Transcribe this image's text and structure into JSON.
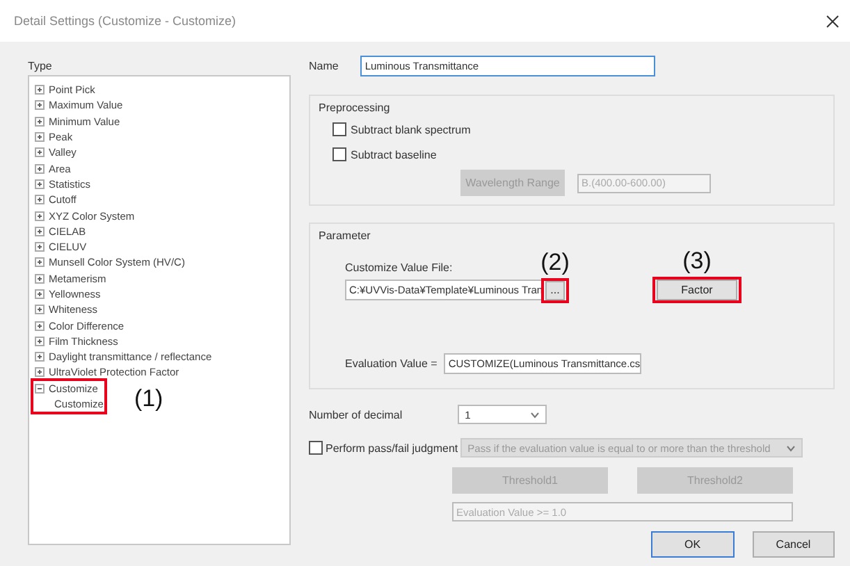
{
  "window": {
    "title": "Detail Settings (Customize - Customize)"
  },
  "type_panel": {
    "label": "Type",
    "tree": [
      {
        "label": "Point Pick",
        "expanded": false
      },
      {
        "label": "Maximum Value",
        "expanded": false
      },
      {
        "label": "Minimum Value",
        "expanded": false
      },
      {
        "label": "Peak",
        "expanded": false
      },
      {
        "label": "Valley",
        "expanded": false
      },
      {
        "label": "Area",
        "expanded": false
      },
      {
        "label": "Statistics",
        "expanded": false
      },
      {
        "label": "Cutoff",
        "expanded": false
      },
      {
        "label": "XYZ Color System",
        "expanded": false
      },
      {
        "label": "CIELAB",
        "expanded": false
      },
      {
        "label": "CIELUV",
        "expanded": false
      },
      {
        "label": "Munsell Color System (HV/C)",
        "expanded": false
      },
      {
        "label": "Metamerism",
        "expanded": false
      },
      {
        "label": "Yellowness",
        "expanded": false
      },
      {
        "label": "Whiteness",
        "expanded": false
      },
      {
        "label": "Color Difference",
        "expanded": false
      },
      {
        "label": "Film Thickness",
        "expanded": false
      },
      {
        "label": "Daylight transmittance / reflectance",
        "expanded": false
      },
      {
        "label": "UltraViolet Protection Factor",
        "expanded": false
      },
      {
        "label": "Customize",
        "expanded": true,
        "callout": "(1)",
        "children": [
          {
            "label": "Customize"
          }
        ]
      }
    ]
  },
  "name": {
    "label": "Name",
    "value": "Luminous Transmittance"
  },
  "preprocessing": {
    "title": "Preprocessing",
    "options": [
      {
        "label": "Subtract blank spectrum",
        "checked": false
      },
      {
        "label": "Subtract baseline",
        "checked": false
      }
    ],
    "range_button": {
      "label": "Wavelength Range",
      "disabled": true
    },
    "range_value": "B.(400.00-600.00)"
  },
  "parameter": {
    "title": "Parameter",
    "file_label": "Customize Value File:",
    "file_value": "C:¥UVVis-Data¥Template¥Luminous Tran",
    "browse_button": {
      "label": "...",
      "callout": "(2)"
    },
    "factor_button": {
      "label": "Factor",
      "callout": "(3)"
    },
    "evaluation_label": "Evaluation Value =",
    "evaluation_value": "CUSTOMIZE(Luminous Transmittance.cs"
  },
  "decimal": {
    "label": "Number of decimal",
    "value": "1"
  },
  "judgment": {
    "label": "Perform pass/fail judgment",
    "checked": false,
    "disabled": true,
    "mode": "Pass if the evaluation value is equal to or more than the threshold",
    "buttons": [
      "Threshold1",
      "Threshold2"
    ],
    "expression": "Evaluation Value >= 1.0"
  },
  "footer_buttons": [
    {
      "label": "OK",
      "default": true
    },
    {
      "label": "Cancel",
      "default": false
    }
  ]
}
